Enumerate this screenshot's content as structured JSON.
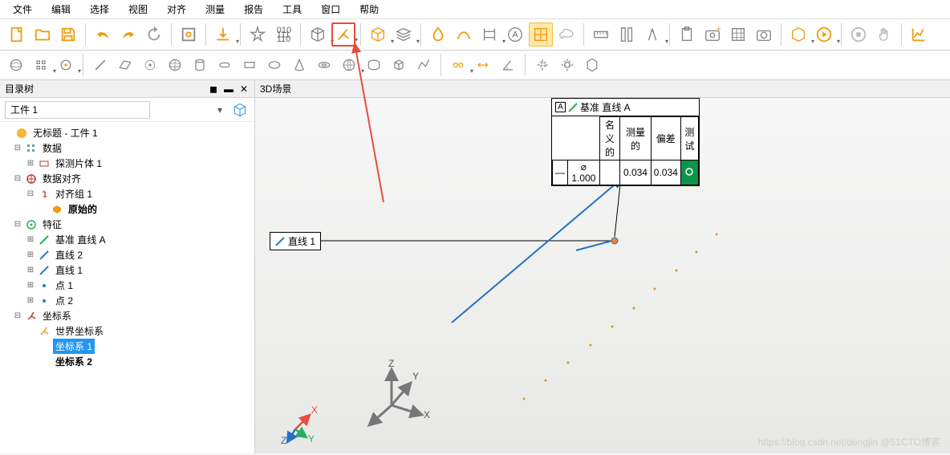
{
  "menubar": [
    "文件",
    "编辑",
    "选择",
    "视图",
    "对齐",
    "测量",
    "报告",
    "工具",
    "窗口",
    "帮助"
  ],
  "sidebar": {
    "title": "目录树",
    "part_selector": "工件 1",
    "tree": {
      "root": "无标题 - 工件 1",
      "data": "数据",
      "probe": "探测片体 1",
      "align_group_title": "数据对齐",
      "align_group": "对齐组 1",
      "original": "原始的",
      "features": "特征",
      "datum_line_a": "基准 直线 A",
      "line2": "直线 2",
      "line1": "直线 1",
      "point1": "点 1",
      "point2": "点 2",
      "coord_sys": "坐标系",
      "world_cs": "世界坐标系",
      "cs1": "坐标系 1",
      "cs2": "坐标系 2"
    }
  },
  "viewport": {
    "title": "3D场景",
    "label_line1": "直线 1",
    "callout": {
      "badge": "A",
      "title": "基准 直线 A",
      "headers": [
        "名义的",
        "测量的",
        "偏差",
        "测试"
      ],
      "symbol": "⌀",
      "nominal": "1.000",
      "measured": "",
      "deviation1": "0.034",
      "deviation2": "0.034"
    },
    "axes": {
      "x": "X",
      "y": "Y",
      "z": "Z"
    }
  },
  "watermark": "https://blog.csdn.net/dengjin @51CTO博客"
}
